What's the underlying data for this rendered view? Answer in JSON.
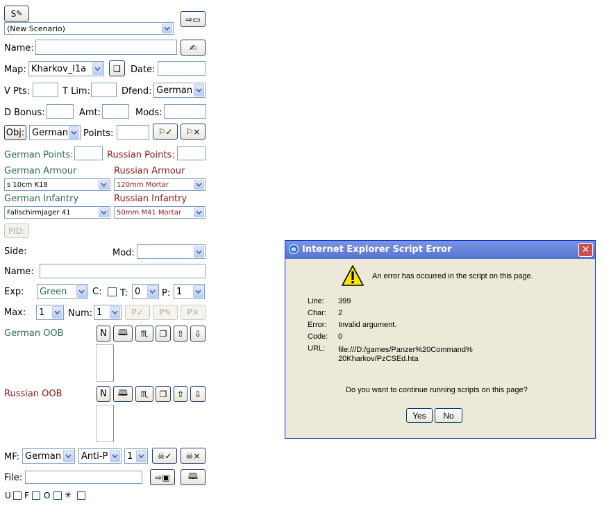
{
  "form": {
    "scenario_select": "(New Scenario)",
    "name_label": "Name:",
    "name_value": "",
    "map_label": "Map:",
    "map_value": "Kharkov_l1a",
    "date_label": "Date:",
    "vpts_label": "V Pts:",
    "tlim_label": "T Lim:",
    "dfend_label": "Dfend:",
    "dfend_value": "German",
    "dbonus_label": "D Bonus:",
    "amt_label": "Amt:",
    "mods_label": "Mods:",
    "obj_button": "Obj:",
    "obj_side": "German",
    "points_label": "Points:",
    "german_points_label": "German Points:",
    "russian_points_label": "Russian Points:",
    "german_armour_label": "German Armour",
    "russian_armour_label": "Russian Armour",
    "german_armour_value": "s 10cm K18",
    "russian_armour_value": "120mm Mortar",
    "german_infantry_label": "German Infantry",
    "russian_infantry_label": "Russian Infantry",
    "german_infantry_value": "Fallschirmjager 41",
    "russian_infantry_value": "50mm M41 Mortar",
    "pid_button": "PID:",
    "side_label": "Side:",
    "mod_label": "Mod:",
    "unit_name_label": "Name:",
    "exp_label": "Exp:",
    "exp_value": "Green",
    "c_label": "C:",
    "t_label": "T:",
    "t_value": "0",
    "p_label": "P:",
    "p_value": "1",
    "max_label": "Max:",
    "max_value": "1",
    "num_label": "Num:",
    "num_value": "1",
    "german_oob_label": "German OOB",
    "russian_oob_label": "Russian OOB",
    "oob_n_button": "N",
    "mf_label": "MF:",
    "mf_side": "German",
    "mf_type": "Anti-P",
    "mf_num": "1",
    "file_label": "File:",
    "flags": [
      "U",
      "F",
      "O",
      "✳"
    ]
  },
  "dialog": {
    "title": "Internet Explorer Script Error",
    "message": "An error has occurred in the script on this page.",
    "line_label": "Line:",
    "line_value": "399",
    "char_label": "Char:",
    "char_value": "2",
    "error_label": "Error:",
    "error_value": "Invalid argument.",
    "code_label": "Code:",
    "code_value": "0",
    "url_label": "URL:",
    "url_value_1": "file:///D:/games/Panzer%20Command%",
    "url_value_2": "20Kharkov/PzCSEd.hta",
    "question": "Do you want to continue running scripts on this page?",
    "yes_label": "Yes",
    "no_label": "No"
  },
  "colors": {
    "german": "#2b6a52",
    "russian": "#8b1a1a",
    "dialog_bg": "#ece9d8",
    "titlebar": "#5573d3"
  }
}
